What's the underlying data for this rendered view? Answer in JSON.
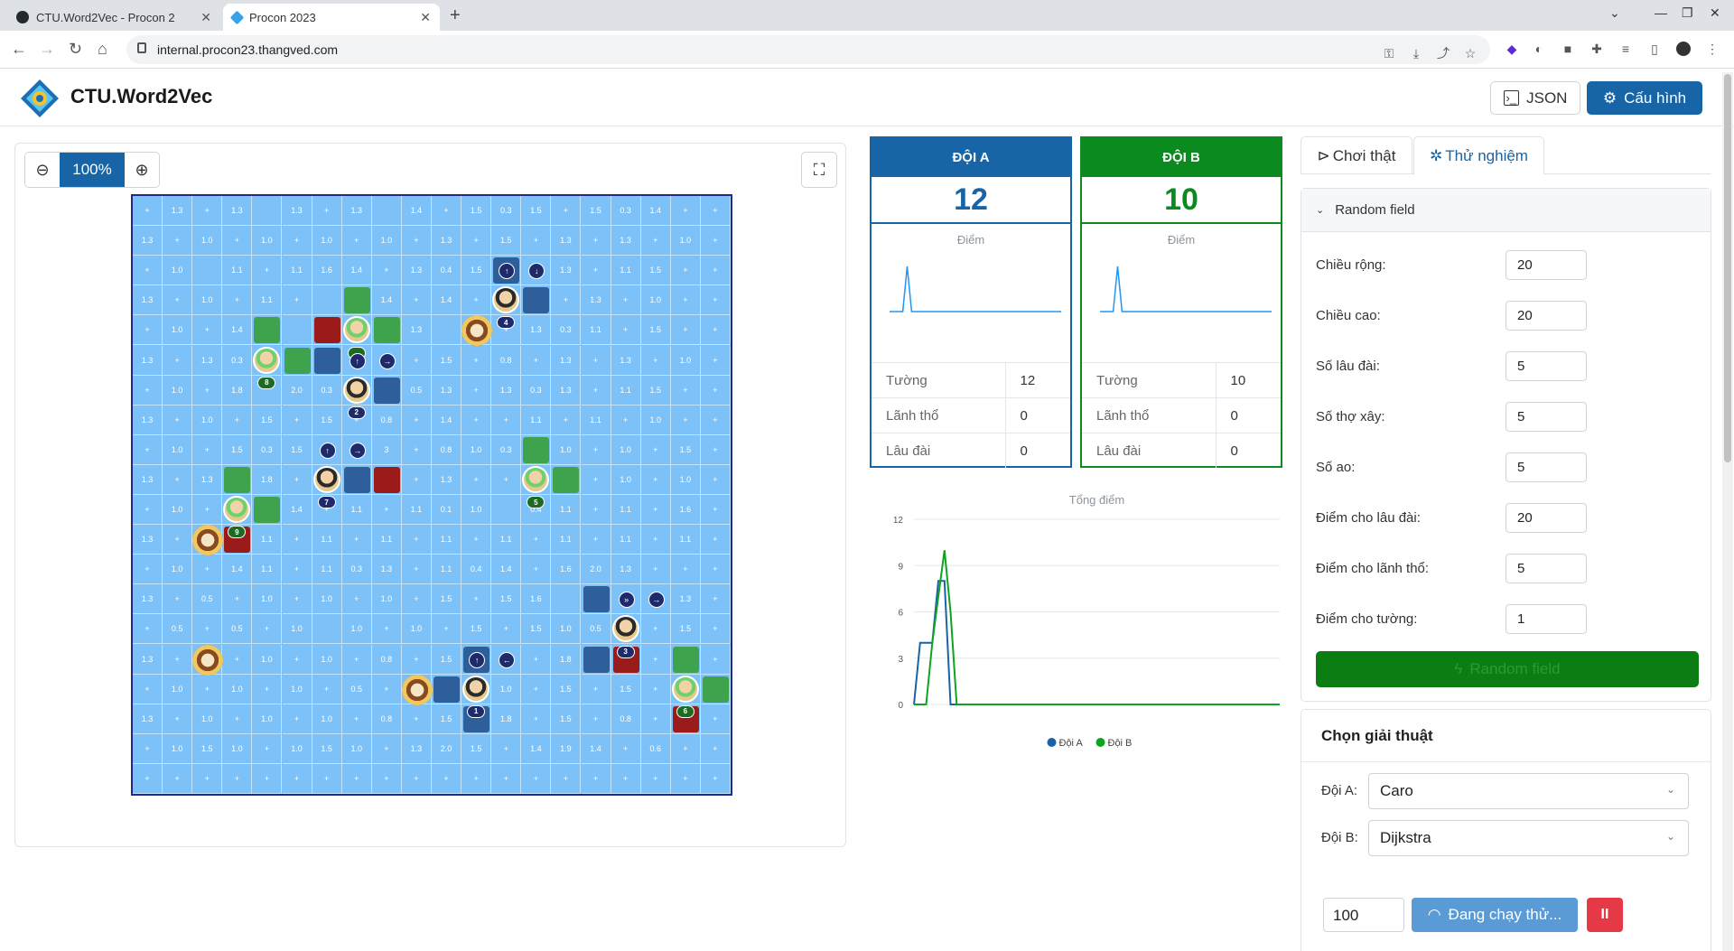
{
  "browser": {
    "tabs": [
      {
        "title": "CTU.Word2Vec - Procon 2",
        "active": false
      },
      {
        "title": "Procon 2023",
        "active": true
      }
    ],
    "url": "internal.procon23.thangved.com"
  },
  "header": {
    "brand": "CTU.Word2Vec",
    "json_label": "JSON",
    "config_label": "Cấu hình"
  },
  "board": {
    "zoom": "100%",
    "size": 20,
    "cell_values": [
      [
        "+",
        "1.3",
        "+",
        "1.3",
        "",
        "1.3",
        "+",
        "1.3",
        "",
        "1.4",
        "+",
        "1.5",
        "0.3",
        "1.5",
        "+",
        "1.5",
        "0.3",
        "1.4",
        "+",
        "+"
      ],
      [
        "1.3",
        "+",
        "1.0",
        "+",
        "1.0",
        "+",
        "1.0",
        "+",
        "1.0",
        "+",
        "1.3",
        "+",
        "1.5",
        "+",
        "1.3",
        "+",
        "1.3",
        "+",
        "1.0",
        "+"
      ],
      [
        "+",
        "1.0",
        "",
        "1.1",
        "+",
        "1.1",
        "1.6",
        "1.4",
        "+",
        "1.3",
        "0.4",
        "1.5",
        "",
        "0.5",
        "1.3",
        "+",
        "1.1",
        "1.5",
        "+",
        "+"
      ],
      [
        "1.3",
        "+",
        "1.0",
        "+",
        "1.1",
        "+",
        "",
        "+",
        "1.4",
        "+",
        "1.4",
        "+",
        "+",
        "1.5",
        "+",
        "1.3",
        "+",
        "1.0",
        "+",
        "+"
      ],
      [
        "+",
        "1.0",
        "+",
        "1.4",
        "",
        "",
        "",
        "",
        "",
        "1.3",
        "",
        "",
        "+",
        "1.3",
        "0.3",
        "1.1",
        "+",
        "1.5",
        "+",
        "+"
      ],
      [
        "1.3",
        "+",
        "1.3",
        "0.3",
        "",
        "",
        "",
        "",
        "5",
        "+",
        "1.5",
        "+",
        "0.8",
        "+",
        "1.3",
        "+",
        "1.3",
        "+",
        "1.0",
        "+"
      ],
      [
        "+",
        "1.0",
        "+",
        "1.8",
        "",
        "2.0",
        "0.3",
        "",
        "1.4",
        "0.5",
        "1.3",
        "+",
        "1.3",
        "0.3",
        "1.3",
        "+",
        "1.1",
        "1.5",
        "+",
        "+"
      ],
      [
        "1.3",
        "+",
        "1.0",
        "+",
        "1.5",
        "+",
        "1.5",
        "+",
        "0.8",
        "+",
        "1.4",
        "+",
        "+",
        "1.1",
        "+",
        "1.1",
        "+",
        "1.0",
        "+",
        "+"
      ],
      [
        "+",
        "1.0",
        "+",
        "1.5",
        "0.3",
        "1.5",
        "",
        "",
        "3",
        "+",
        "0.8",
        "1.0",
        "0.3",
        "",
        "1.0",
        "+",
        "1.0",
        "+",
        "1.5",
        "+"
      ],
      [
        "1.3",
        "+",
        "1.3",
        "",
        "1.8",
        "+",
        "",
        "+",
        "+",
        "+",
        "1.3",
        "+",
        "+",
        "+",
        "1.0",
        "+",
        "1.0",
        "+",
        "1.0",
        "+"
      ],
      [
        "+",
        "1.0",
        "+",
        "",
        "",
        "1.4",
        "+",
        "1.1",
        "+",
        "1.1",
        "0.1",
        "1.0",
        "",
        "0.4",
        "1.1",
        "+",
        "1.1",
        "+",
        "1.6",
        "+"
      ],
      [
        "1.3",
        "+",
        "",
        "",
        "1.1",
        "+",
        "1.1",
        "+",
        "1.1",
        "+",
        "1.1",
        "+",
        "1.1",
        "+",
        "1.1",
        "+",
        "1.1",
        "+",
        "1.1",
        "+"
      ],
      [
        "+",
        "1.0",
        "+",
        "1.4",
        "1.1",
        "+",
        "1.1",
        "0.3",
        "1.3",
        "+",
        "1.1",
        "0.4",
        "1.4",
        "+",
        "1.6",
        "2.0",
        "1.3",
        "+",
        "+",
        "+"
      ],
      [
        "1.3",
        "+",
        "0.5",
        "+",
        "1.0",
        "+",
        "1.0",
        "+",
        "1.0",
        "+",
        "1.5",
        "+",
        "1.5",
        "1.6",
        "",
        "",
        "+",
        "+",
        "1.3",
        "+"
      ],
      [
        "+",
        "0.5",
        "+",
        "0.5",
        "+",
        "1.0",
        "",
        "1.0",
        "+",
        "1.0",
        "+",
        "1.5",
        "+",
        "1.5",
        "1.0",
        "0.5",
        "",
        "+",
        "1.5",
        "+"
      ],
      [
        "1.3",
        "+",
        "",
        "+",
        "1.0",
        "+",
        "1.0",
        "+",
        "0.8",
        "+",
        "1.5",
        "",
        "8",
        "+",
        "1.8",
        "",
        "",
        "+",
        "+",
        "+"
      ],
      [
        "+",
        "1.0",
        "+",
        "1.0",
        "+",
        "1.0",
        "+",
        "0.5",
        "+",
        "",
        "",
        "",
        "1.0",
        "+",
        "1.5",
        "+",
        "1.5",
        "+",
        "1.3",
        "+"
      ],
      [
        "1.3",
        "+",
        "1.0",
        "+",
        "1.0",
        "+",
        "1.0",
        "+",
        "0.8",
        "+",
        "1.5",
        "",
        "1.8",
        "+",
        "1.5",
        "+",
        "0.8",
        "+",
        "",
        "+"
      ],
      [
        "+",
        "1.0",
        "1.5",
        "1.0",
        "+",
        "1.0",
        "1.5",
        "1.0",
        "+",
        "1.3",
        "2.0",
        "1.5",
        "+",
        "1.4",
        "1.9",
        "1.4",
        "+",
        "0.6",
        "+",
        "+"
      ],
      [
        "+",
        "+",
        "+",
        "+",
        "+",
        "+",
        "+",
        "+",
        "+",
        "+",
        "+",
        "+",
        "+",
        "+",
        "+",
        "+",
        "+",
        "+",
        "+",
        "+"
      ]
    ],
    "walls": [
      {
        "r": 3,
        "c": 7,
        "team": "green"
      },
      {
        "r": 4,
        "c": 4,
        "team": "green"
      },
      {
        "r": 4,
        "c": 6,
        "team": "red"
      },
      {
        "r": 4,
        "c": 8,
        "team": "green"
      },
      {
        "r": 5,
        "c": 5,
        "team": "green"
      },
      {
        "r": 5,
        "c": 6,
        "team": "blue"
      },
      {
        "r": 6,
        "c": 8,
        "team": "blue"
      },
      {
        "r": 2,
        "c": 12,
        "team": "blue"
      },
      {
        "r": 3,
        "c": 13,
        "team": "blue"
      },
      {
        "r": 8,
        "c": 13,
        "team": "green"
      },
      {
        "r": 9,
        "c": 14,
        "team": "green"
      },
      {
        "r": 9,
        "c": 3,
        "team": "green"
      },
      {
        "r": 10,
        "c": 4,
        "team": "green"
      },
      {
        "r": 9,
        "c": 7,
        "team": "blue"
      },
      {
        "r": 9,
        "c": 8,
        "team": "red"
      },
      {
        "r": 13,
        "c": 15,
        "team": "blue"
      },
      {
        "r": 15,
        "c": 15,
        "team": "blue"
      },
      {
        "r": 15,
        "c": 16,
        "team": "red"
      },
      {
        "r": 15,
        "c": 18,
        "team": "green"
      },
      {
        "r": 16,
        "c": 19,
        "team": "green"
      },
      {
        "r": 17,
        "c": 18,
        "team": "red"
      },
      {
        "r": 16,
        "c": 10,
        "team": "blue"
      },
      {
        "r": 15,
        "c": 11,
        "team": "blue"
      },
      {
        "r": 17,
        "c": 11,
        "team": "blue"
      },
      {
        "r": 11,
        "c": 3,
        "team": "red"
      }
    ],
    "agents": [
      {
        "r": 5,
        "c": 4,
        "team": "B",
        "label": "8"
      },
      {
        "r": 4,
        "c": 7,
        "team": "B",
        "label": ""
      },
      {
        "r": 10,
        "c": 3,
        "team": "B",
        "label": "9"
      },
      {
        "r": 9,
        "c": 13,
        "team": "B",
        "label": "5"
      },
      {
        "r": 16,
        "c": 18,
        "team": "B",
        "label": "6"
      },
      {
        "r": 3,
        "c": 12,
        "team": "A",
        "label": "4"
      },
      {
        "r": 6,
        "c": 7,
        "team": "A",
        "label": "2"
      },
      {
        "r": 9,
        "c": 6,
        "team": "A",
        "label": "7"
      },
      {
        "r": 14,
        "c": 16,
        "team": "A",
        "label": "3"
      },
      {
        "r": 16,
        "c": 11,
        "team": "A",
        "label": "1"
      }
    ],
    "castles": [
      {
        "r": 4,
        "c": 11
      },
      {
        "r": 11,
        "c": 2
      },
      {
        "r": 15,
        "c": 2
      },
      {
        "r": 16,
        "c": 9
      }
    ],
    "actions": [
      {
        "r": 2,
        "c": 12,
        "glyph": "↑"
      },
      {
        "r": 2,
        "c": 13,
        "glyph": "↓"
      },
      {
        "r": 5,
        "c": 7,
        "glyph": "↑"
      },
      {
        "r": 5,
        "c": 8,
        "glyph": "→"
      },
      {
        "r": 8,
        "c": 6,
        "glyph": "↑"
      },
      {
        "r": 8,
        "c": 7,
        "glyph": "→"
      },
      {
        "r": 13,
        "c": 16,
        "glyph": "»"
      },
      {
        "r": 13,
        "c": 17,
        "glyph": "→"
      },
      {
        "r": 15,
        "c": 11,
        "glyph": "↑"
      },
      {
        "r": 15,
        "c": 12,
        "glyph": "←"
      }
    ]
  },
  "teams": [
    {
      "name": "ĐỘI A",
      "score": "12",
      "subtitle": "Điểm",
      "color": "#1765a6",
      "stats": [
        {
          "label": "Tường",
          "value": "12"
        },
        {
          "label": "Lãnh thổ",
          "value": "0"
        },
        {
          "label": "Lâu đài",
          "value": "0"
        }
      ],
      "history": [
        0,
        0,
        0,
        0,
        12,
        0,
        0,
        0,
        0,
        0,
        0,
        0,
        0,
        0,
        0,
        0,
        0,
        0,
        0,
        0,
        0,
        0,
        0,
        0,
        0,
        0,
        0,
        0,
        0,
        0,
        0,
        0,
        0,
        0,
        0,
        0,
        0,
        0,
        0,
        0
      ]
    },
    {
      "name": "ĐỘI B",
      "score": "10",
      "subtitle": "Điểm",
      "color": "#0b8a1f",
      "stats": [
        {
          "label": "Tường",
          "value": "10"
        },
        {
          "label": "Lãnh thổ",
          "value": "0"
        },
        {
          "label": "Lâu đài",
          "value": "0"
        }
      ],
      "history": [
        0,
        0,
        0,
        0,
        10,
        0,
        0,
        0,
        0,
        0,
        0,
        0,
        0,
        0,
        0,
        0,
        0,
        0,
        0,
        0,
        0,
        0,
        0,
        0,
        0,
        0,
        0,
        0,
        0,
        0,
        0,
        0,
        0,
        0,
        0,
        0,
        0,
        0,
        0,
        0
      ]
    }
  ],
  "chart_data": {
    "type": "line",
    "title": "Tổng điểm",
    "xlabel": "",
    "ylabel": "",
    "ylim": [
      0,
      12
    ],
    "yticks": [
      0,
      3,
      6,
      9,
      12
    ],
    "grid": true,
    "legend_position": "bottom",
    "x": [
      0,
      1,
      2,
      3,
      4,
      5,
      6,
      7,
      8,
      9,
      10,
      11,
      12,
      13,
      14,
      15,
      16,
      17,
      18,
      19,
      20,
      21,
      22,
      23,
      24,
      25,
      26,
      27,
      28,
      29,
      30,
      31,
      32,
      33,
      34,
      35,
      36,
      37,
      38,
      39,
      40,
      41,
      42,
      43,
      44,
      45,
      46,
      47,
      48,
      49,
      50,
      51,
      52,
      53,
      54,
      55,
      56,
      57,
      58,
      59,
      60
    ],
    "series": [
      {
        "name": "Đội A",
        "color": "#1765a6",
        "values": [
          0,
          4,
          4,
          4,
          8,
          8,
          0,
          0,
          0,
          0,
          0,
          0,
          0,
          0,
          0,
          0,
          0,
          0,
          0,
          0,
          0,
          0,
          0,
          0,
          0,
          0,
          0,
          0,
          0,
          0,
          0,
          0,
          0,
          0,
          0,
          0,
          0,
          0,
          0,
          0,
          0,
          0,
          0,
          0,
          0,
          0,
          0,
          0,
          0,
          0,
          0,
          0,
          0,
          0,
          0,
          0,
          0,
          0,
          0,
          0,
          0
        ]
      },
      {
        "name": "Đội B",
        "color": "#0ea320",
        "values": [
          0,
          0,
          0,
          4,
          7,
          10,
          6,
          0,
          0,
          0,
          0,
          0,
          0,
          0,
          0,
          0,
          0,
          0,
          0,
          0,
          0,
          0,
          0,
          0,
          0,
          0,
          0,
          0,
          0,
          0,
          0,
          0,
          0,
          0,
          0,
          0,
          0,
          0,
          0,
          0,
          0,
          0,
          0,
          0,
          0,
          0,
          0,
          0,
          0,
          0,
          0,
          0,
          0,
          0,
          0,
          0,
          0,
          0,
          0,
          0,
          0
        ]
      }
    ]
  },
  "right": {
    "tab_real": "Chơi thật",
    "tab_test": "Thử nghiệm",
    "random_field": {
      "title": "Random field",
      "fields": [
        {
          "label": "Chiều rộng:",
          "value": "20"
        },
        {
          "label": "Chiều cao:",
          "value": "20"
        },
        {
          "label": "Số lâu đài:",
          "value": "5"
        },
        {
          "label": "Số thợ xây:",
          "value": "5"
        },
        {
          "label": "Số ao:",
          "value": "5"
        },
        {
          "label": "Điểm cho lâu đài:",
          "value": "20"
        },
        {
          "label": "Điểm cho lãnh thổ:",
          "value": "5"
        },
        {
          "label": "Điểm cho tường:",
          "value": "1"
        }
      ],
      "button": "Random field"
    },
    "algo": {
      "title": "Chọn giải thuật",
      "team_a_label": "Đội A:",
      "team_a_value": "Caro",
      "team_b_label": "Đội B:",
      "team_b_value": "Dijkstra",
      "steps": "100",
      "running_label": "Đang chạy thử...",
      "stop_label": "II"
    }
  }
}
